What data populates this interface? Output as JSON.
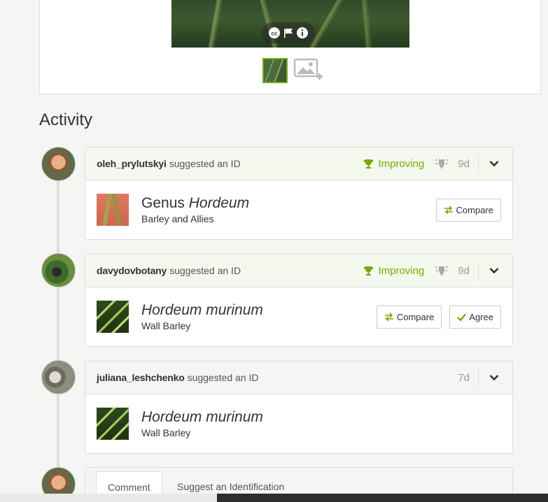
{
  "photo_viewer": {
    "toolbar_icons": [
      "cc-license-icon",
      "flag-icon",
      "info-icon"
    ],
    "add_photo_icon": "add-photo-icon"
  },
  "activity": {
    "title": "Activity",
    "items": [
      {
        "user": "oleh_prylutskyi",
        "action": "suggested an ID",
        "status": "Improving",
        "age": "9d",
        "taxon_rank": "Genus",
        "taxon_name": "Hordeum",
        "common_name": "Barley and Allies",
        "compare_label": "Compare"
      },
      {
        "user": "davydovbotany",
        "action": "suggested an ID",
        "status": "Improving",
        "age": "9d",
        "taxon_name": "Hordeum murinum",
        "common_name": "Wall Barley",
        "compare_label": "Compare",
        "agree_label": "Agree"
      },
      {
        "user": "juliana_leshchenko",
        "action": "suggested an ID",
        "age": "7d",
        "taxon_name": "Hordeum murinum",
        "common_name": "Wall Barley"
      }
    ]
  },
  "comment_box": {
    "tabs": [
      "Comment",
      "Suggest an Identification"
    ]
  },
  "colors": {
    "accent_green": "#74ac00",
    "border": "#dddddd",
    "background": "#f5f5f3"
  }
}
